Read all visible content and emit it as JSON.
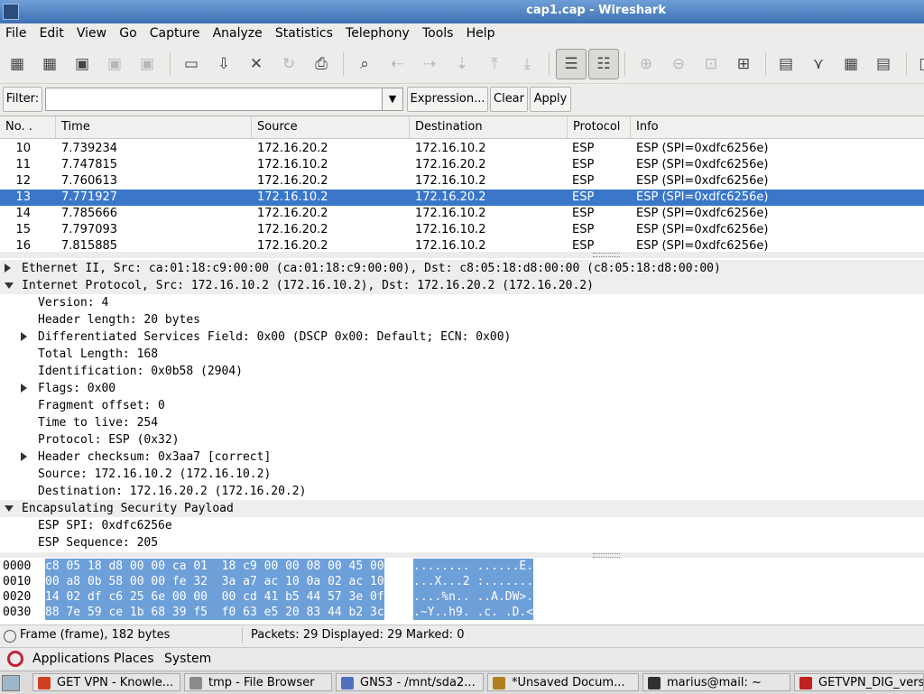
{
  "window": {
    "title": "cap1.cap - Wireshark"
  },
  "menu": [
    "File",
    "Edit",
    "View",
    "Go",
    "Capture",
    "Analyze",
    "Statistics",
    "Telephony",
    "Tools",
    "Help"
  ],
  "filter": {
    "label": "Filter:",
    "value": "",
    "expression_label": "Expression...",
    "clear_label": "Clear",
    "apply_label": "Apply"
  },
  "packet_list": {
    "columns": [
      "No. .",
      "Time",
      "Source",
      "Destination",
      "Protocol",
      "Info"
    ],
    "rows": [
      {
        "no": "10",
        "time": "7.739234",
        "src": "172.16.20.2",
        "dst": "172.16.10.2",
        "proto": "ESP",
        "info": "ESP (SPI=0xdfc6256e)"
      },
      {
        "no": "11",
        "time": "7.747815",
        "src": "172.16.10.2",
        "dst": "172.16.20.2",
        "proto": "ESP",
        "info": "ESP (SPI=0xdfc6256e)"
      },
      {
        "no": "12",
        "time": "7.760613",
        "src": "172.16.20.2",
        "dst": "172.16.10.2",
        "proto": "ESP",
        "info": "ESP (SPI=0xdfc6256e)"
      },
      {
        "no": "13",
        "time": "7.771927",
        "src": "172.16.10.2",
        "dst": "172.16.20.2",
        "proto": "ESP",
        "info": "ESP (SPI=0xdfc6256e)"
      },
      {
        "no": "14",
        "time": "7.785666",
        "src": "172.16.20.2",
        "dst": "172.16.10.2",
        "proto": "ESP",
        "info": "ESP (SPI=0xdfc6256e)"
      },
      {
        "no": "15",
        "time": "7.797093",
        "src": "172.16.20.2",
        "dst": "172.16.10.2",
        "proto": "ESP",
        "info": "ESP (SPI=0xdfc6256e)"
      },
      {
        "no": "16",
        "time": "7.815885",
        "src": "172.16.20.2",
        "dst": "172.16.10.2",
        "proto": "ESP",
        "info": "ESP (SPI=0xdfc6256e)"
      }
    ]
  },
  "details": [
    {
      "text": "Ethernet II, Src: ca:01:18:c9:00:00 (ca:01:18:c9:00:00), Dst: c8:05:18:d8:00:00 (c8:05:18:d8:00:00)",
      "expander": "collapsed",
      "level": 0,
      "header": true
    },
    {
      "text": "Internet Protocol, Src: 172.16.10.2 (172.16.10.2), Dst: 172.16.20.2 (172.16.20.2)",
      "expander": "expanded",
      "level": 0,
      "header": true
    },
    {
      "text": "Version: 4",
      "expander": "none",
      "level": 1
    },
    {
      "text": "Header length: 20 bytes",
      "expander": "none",
      "level": 1
    },
    {
      "text": "Differentiated Services Field: 0x00 (DSCP 0x00: Default; ECN: 0x00)",
      "expander": "collapsed",
      "level": 1
    },
    {
      "text": "Total Length: 168",
      "expander": "none",
      "level": 1
    },
    {
      "text": "Identification: 0x0b58 (2904)",
      "expander": "none",
      "level": 1
    },
    {
      "text": "Flags: 0x00",
      "expander": "collapsed",
      "level": 1
    },
    {
      "text": "Fragment offset: 0",
      "expander": "none",
      "level": 1
    },
    {
      "text": "Time to live: 254",
      "expander": "none",
      "level": 1
    },
    {
      "text": "Protocol: ESP (0x32)",
      "expander": "none",
      "level": 1
    },
    {
      "text": "Header checksum: 0x3aa7 [correct]",
      "expander": "collapsed",
      "level": 1
    },
    {
      "text": "Source: 172.16.10.2 (172.16.10.2)",
      "expander": "none",
      "level": 1
    },
    {
      "text": "Destination: 172.16.20.2 (172.16.20.2)",
      "expander": "none",
      "level": 1
    },
    {
      "text": "Encapsulating Security Payload",
      "expander": "expanded",
      "level": 0,
      "header": true
    },
    {
      "text": "ESP SPI: 0xdfc6256e",
      "expander": "none",
      "level": 1
    },
    {
      "text": "ESP Sequence: 205",
      "expander": "none",
      "level": 1
    }
  ],
  "hex": [
    {
      "offset": "0000",
      "bytes": "c8 05 18 d8 00 00 ca 01  18 c9 00 00 08 00 45 00",
      "ascii": "........ ......E."
    },
    {
      "offset": "0010",
      "bytes": "00 a8 0b 58 00 00 fe 32  3a a7 ac 10 0a 02 ac 10",
      "ascii": "...X...2 :......."
    },
    {
      "offset": "0020",
      "bytes": "14 02 df c6 25 6e 00 00  00 cd 41 b5 44 57 3e 0f",
      "ascii": "....%n.. ..A.DW>."
    },
    {
      "offset": "0030",
      "bytes": "88 7e 59 ce 1b 68 39 f5  f0 63 e5 20 83 44 b2 3c",
      "ascii": ".~Y..h9. .c. .D.<"
    }
  ],
  "status": {
    "left": "Frame (frame), 182 bytes",
    "right": "Packets: 29 Displayed: 29 Marked: 0"
  },
  "panel": [
    "Applications",
    "Places",
    "System"
  ],
  "taskbar": [
    {
      "label": "GET VPN - Knowle...",
      "icon_color": "#d04020"
    },
    {
      "label": "tmp - File Browser",
      "icon_color": "#8a8a8a"
    },
    {
      "label": "GNS3 - /mnt/sda2...",
      "icon_color": "#5070c0"
    },
    {
      "label": "*Unsaved Docum...",
      "icon_color": "#b08020"
    },
    {
      "label": "marius@mail: ~",
      "icon_color": "#303030"
    },
    {
      "label": "GETVPN_DIG_vers",
      "icon_color": "#c02020"
    }
  ],
  "colors": {
    "selection": "#3a77c9",
    "hex_highlight": "#6d9fd8",
    "titlebar": "#3d70b5"
  }
}
